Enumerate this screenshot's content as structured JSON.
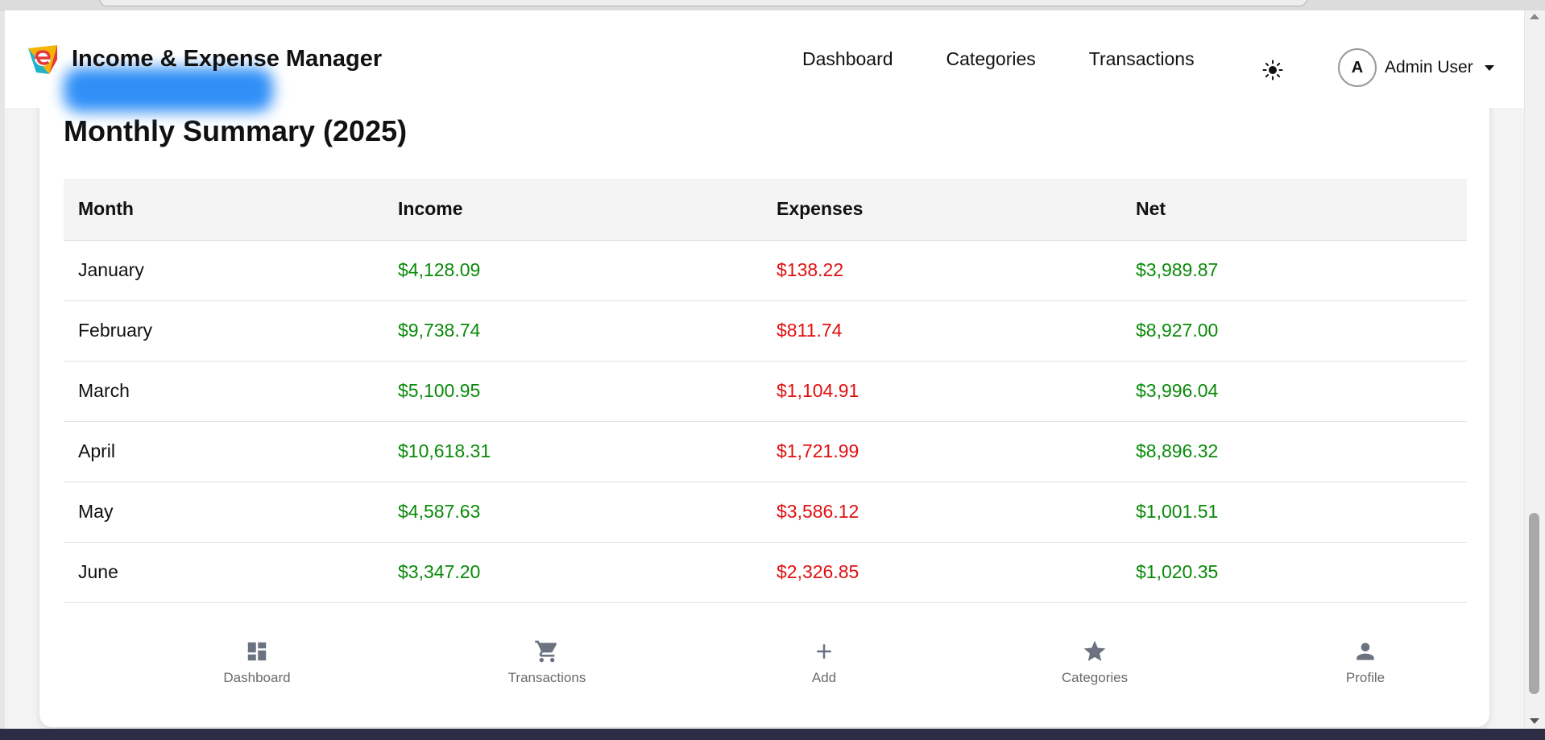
{
  "app": {
    "title": "Income & Expense Manager"
  },
  "nav": {
    "links": [
      "Dashboard",
      "Categories",
      "Transactions"
    ],
    "user_initial": "A",
    "user_name": "Admin User"
  },
  "summary": {
    "title": "Monthly Summary (2025)",
    "headers": [
      "Month",
      "Income",
      "Expenses",
      "Net"
    ],
    "rows": [
      {
        "month": "January",
        "income": "$4,128.09",
        "expenses": "$138.22",
        "net": "$3,989.87"
      },
      {
        "month": "February",
        "income": "$9,738.74",
        "expenses": "$811.74",
        "net": "$8,927.00"
      },
      {
        "month": "March",
        "income": "$5,100.95",
        "expenses": "$1,104.91",
        "net": "$3,996.04"
      },
      {
        "month": "April",
        "income": "$10,618.31",
        "expenses": "$1,721.99",
        "net": "$8,896.32"
      },
      {
        "month": "May",
        "income": "$4,587.63",
        "expenses": "$3,586.12",
        "net": "$1,001.51"
      },
      {
        "month": "June",
        "income": "$3,347.20",
        "expenses": "$2,326.85",
        "net": "$1,020.35"
      }
    ]
  },
  "bottom_nav": {
    "items": [
      {
        "label": "Dashboard",
        "icon": "dashboard-icon"
      },
      {
        "label": "Transactions",
        "icon": "cart-icon"
      },
      {
        "label": "Add",
        "icon": "plus-icon"
      },
      {
        "label": "Categories",
        "icon": "star-icon"
      },
      {
        "label": "Profile",
        "icon": "person-icon"
      }
    ]
  },
  "colors": {
    "positive": "#0a8a0a",
    "negative": "#e01010",
    "brand_highlight": "#2f8ff7"
  }
}
